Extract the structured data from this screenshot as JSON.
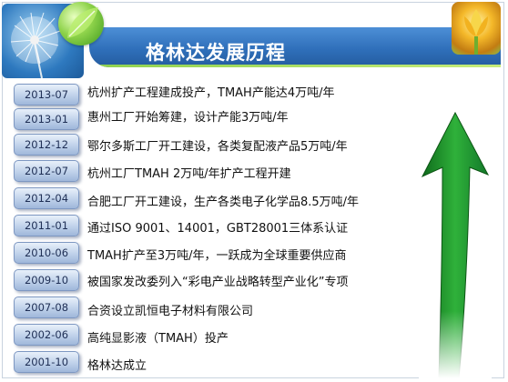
{
  "header": {
    "title": "格林达发展历程"
  },
  "milestones": [
    {
      "date": "2013-07",
      "text": "杭州扩产工程建成投产，TMAH产能达4万吨/年"
    },
    {
      "date": "2013-01",
      "text": "惠州工厂开始筹建，设计产能3万吨/年"
    },
    {
      "date": "2012-12",
      "text": "鄂尔多斯工厂开工建设，各类复配液产品5万吨/年"
    },
    {
      "date": "2012-07",
      "text": "杭州工厂TMAH 2万吨/年扩产工程开建"
    },
    {
      "date": "2012-04",
      "text": "合肥工厂开工建设，生产各类电子化学品8.5万吨/年"
    },
    {
      "date": "2011-01",
      "text": "通过ISO 9001、14001，GBT28001三体系认证"
    },
    {
      "date": "2010-06",
      "text": "TMAH扩产至3万吨/年，一跃成为全球重要供应商"
    },
    {
      "date": "2009-10",
      "text": "被国家发改委列入“彩电产业战略转型产业化”专项"
    },
    {
      "date": "2007-08",
      "text": "合资设立凯恒电子材料有限公司"
    },
    {
      "date": "2002-06",
      "text": "高纯显影液（TMAH）投产"
    },
    {
      "date": "2001-10",
      "text": "格林达成立"
    }
  ],
  "colors": {
    "header": "#2f6fba",
    "arrow": "#1f9a2e",
    "badge": "#bfd1ea"
  },
  "icons": [
    "dandelion-logo",
    "leaf-icon",
    "flower-icon",
    "growth-arrow-icon"
  ]
}
